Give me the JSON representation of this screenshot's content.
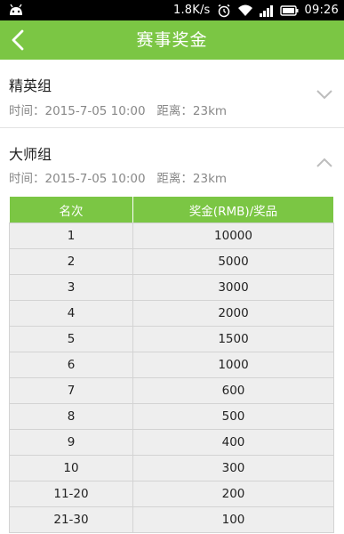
{
  "status_bar": {
    "speed": "1.8K/s",
    "time": "09:26"
  },
  "header": {
    "title": "赛事奖金"
  },
  "sections": [
    {
      "name": "精英组",
      "info": "时间：2015-7-05 10:00   距离：23km",
      "expanded": false
    },
    {
      "name": "大师组",
      "info": "时间：2015-7-05 10:00   距离：23km",
      "expanded": true
    }
  ],
  "table": {
    "headers": [
      "名次",
      "奖金(RMB)/奖品"
    ],
    "rows": [
      [
        "1",
        "10000"
      ],
      [
        "2",
        "5000"
      ],
      [
        "3",
        "3000"
      ],
      [
        "4",
        "2000"
      ],
      [
        "5",
        "1500"
      ],
      [
        "6",
        "1000"
      ],
      [
        "7",
        "600"
      ],
      [
        "8",
        "500"
      ],
      [
        "9",
        "400"
      ],
      [
        "10",
        "300"
      ],
      [
        "11-20",
        "200"
      ],
      [
        "21-30",
        "100"
      ]
    ]
  },
  "colors": {
    "accent": "#7bc644",
    "cell_bg": "#eeeeee"
  },
  "icons": [
    "android-icon",
    "alarm-icon",
    "wifi-icon",
    "signal-icon",
    "battery-icon",
    "back-arrow-icon",
    "chevron-down-icon",
    "chevron-up-icon"
  ]
}
